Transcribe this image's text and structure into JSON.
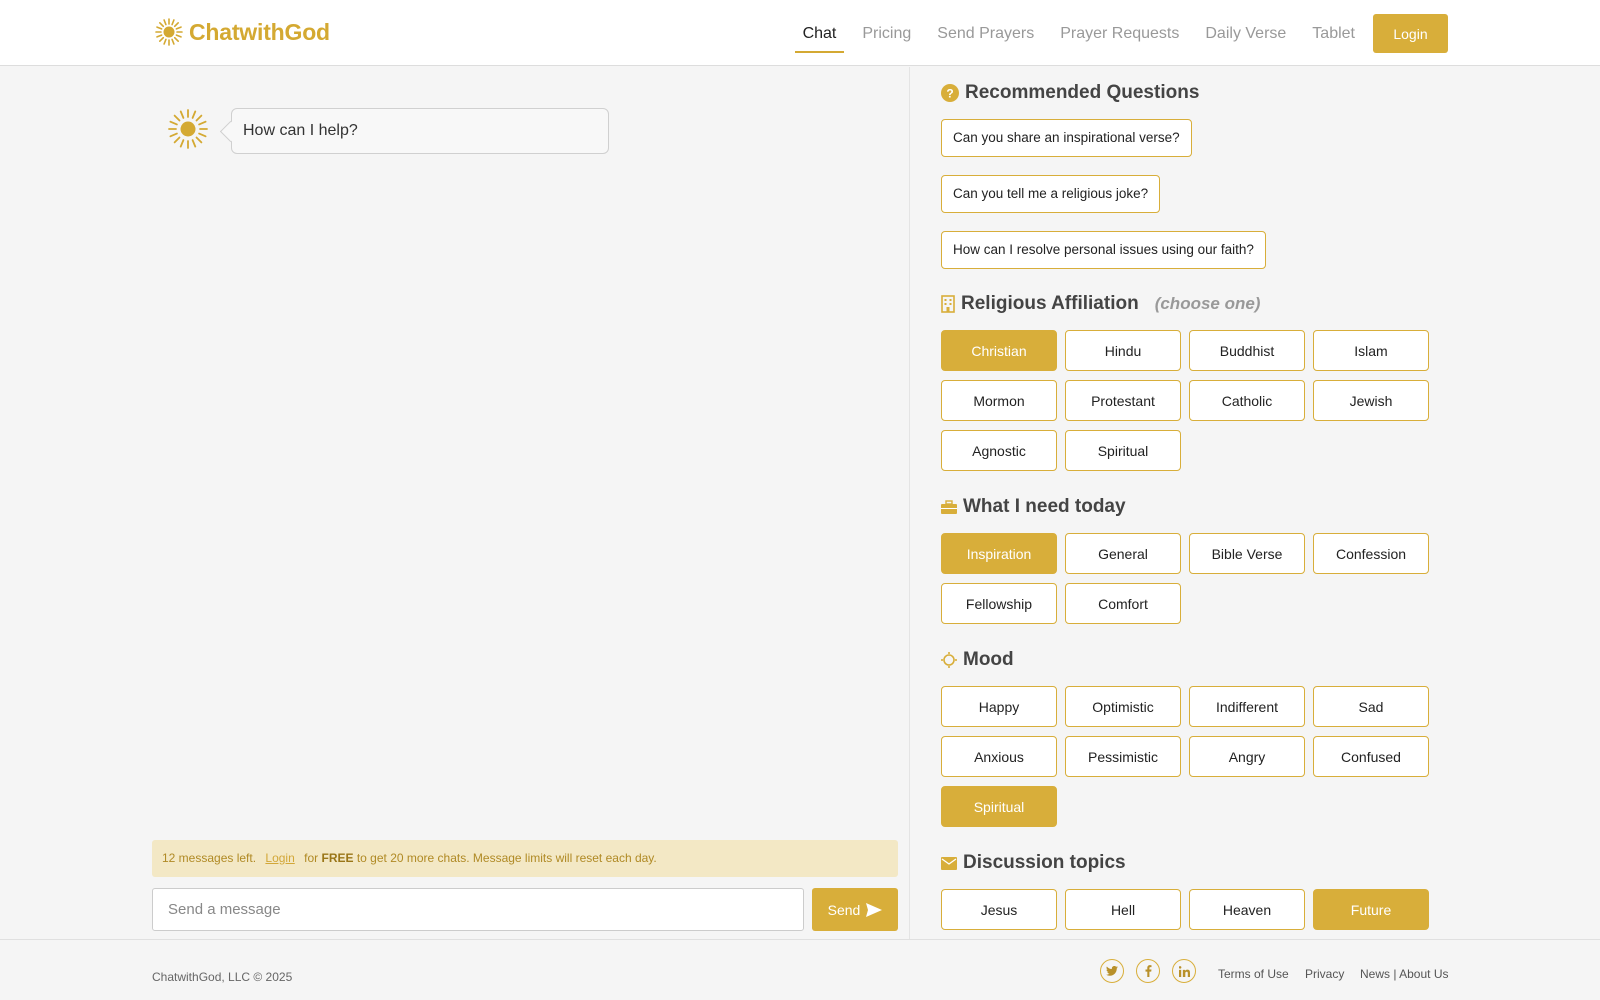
{
  "header": {
    "brand": "ChatwithGod",
    "nav": [
      "Chat",
      "Pricing",
      "Send Prayers",
      "Prayer Requests",
      "Daily Verse",
      "Tablet"
    ],
    "active_nav": "Chat",
    "login_label": "Login"
  },
  "chat": {
    "greeting": "How can I help?",
    "notice": {
      "prefix": "12 messages left.",
      "login_link": "Login",
      "for": "for",
      "free": "FREE",
      "suffix": "to get 20 more chats. Message limits will reset each day."
    },
    "input_placeholder": "Send a message",
    "send_label": "Send"
  },
  "panel": {
    "recommended": {
      "title": "Recommended Questions",
      "questions": [
        "Can you share an inspirational verse?",
        "Can you tell me a religious joke?",
        "How can I resolve personal issues using our faith?"
      ]
    },
    "affiliation": {
      "title": "Religious Affiliation",
      "hint": "(choose one)",
      "options": [
        "Christian",
        "Hindu",
        "Buddhist",
        "Islam",
        "Mormon",
        "Protestant",
        "Catholic",
        "Jewish",
        "Agnostic",
        "Spiritual"
      ],
      "selected": "Christian"
    },
    "need": {
      "title": "What I need today",
      "options": [
        "Inspiration",
        "General",
        "Bible Verse",
        "Confession",
        "Fellowship",
        "Comfort"
      ],
      "selected": "Inspiration"
    },
    "mood": {
      "title": "Mood",
      "options": [
        "Happy",
        "Optimistic",
        "Indifferent",
        "Sad",
        "Anxious",
        "Pessimistic",
        "Angry",
        "Confused",
        "Spiritual"
      ],
      "selected": "Spiritual"
    },
    "topics": {
      "title": "Discussion topics",
      "options": [
        "Jesus",
        "Hell",
        "Heaven",
        "Future"
      ],
      "selected": "Future"
    }
  },
  "footer": {
    "copyright": "ChatwithGod, LLC © 2025",
    "social": [
      "twitter-icon",
      "facebook-icon",
      "linkedin-icon"
    ],
    "links": [
      "Terms of Use",
      "Privacy",
      "News | About Us"
    ]
  },
  "colors": {
    "accent": "#d8ae3a",
    "notice_bg": "#f3e8c5"
  }
}
